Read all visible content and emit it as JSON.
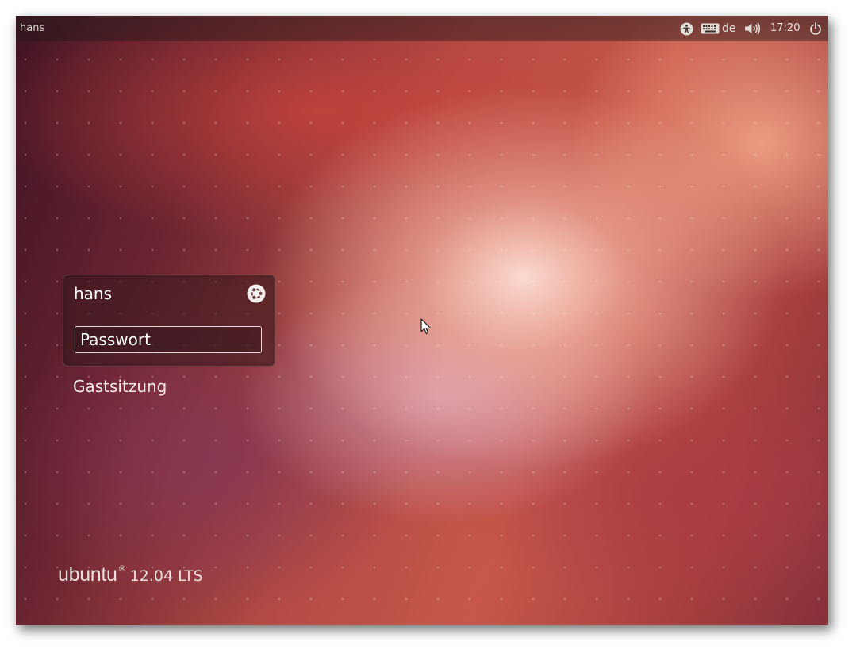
{
  "panel": {
    "title": "hans",
    "indicators": {
      "accessibility_icon": "accessibility-icon",
      "keyboard_icon": "keyboard-icon",
      "keyboard_layout": "de",
      "sound_icon": "speaker-volume-icon",
      "clock": "17:20",
      "power_icon": "power-icon"
    }
  },
  "login": {
    "username": "hans",
    "session_icon": "ubuntu-session-icon",
    "password_placeholder": "Passwort",
    "guest_label": "Gastsitzung"
  },
  "branding": {
    "word": "ubuntu",
    "registered": "®",
    "version": "12.04 LTS"
  },
  "colors": {
    "wallpaper_dark": "#3f1323",
    "wallpaper_mid": "#b24a44",
    "wallpaper_light": "#f9d8cf",
    "text": "#ffffff"
  }
}
